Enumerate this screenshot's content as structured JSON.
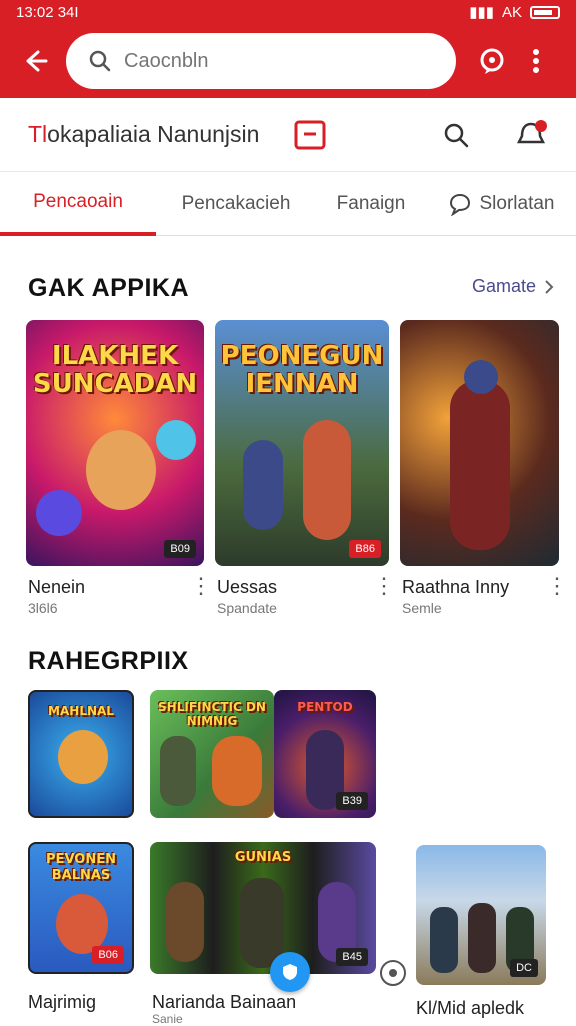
{
  "status": {
    "time": "13:02 34I",
    "battery_label": "AK"
  },
  "search": {
    "placeholder": "Caocnbln"
  },
  "header": {
    "title_prefix": "Tl",
    "title_rest": "okapaliaia Nanunjsin"
  },
  "tabs": [
    {
      "label": "Pencaoain"
    },
    {
      "label": "Pencakacieh"
    },
    {
      "label": "Fanaign"
    },
    {
      "label": "Slorlatan"
    }
  ],
  "section1": {
    "title": "GAK APPIKA",
    "see_all": "Gamate",
    "games": [
      {
        "name": "Nenein",
        "sub": "3l6l6",
        "cover_text": "ILAKHEK SUNCADAN",
        "badge": "B09"
      },
      {
        "name": "Uessas",
        "sub": "Spandate",
        "cover_text": "PEONEGUN IENNAN",
        "badge": "B86"
      },
      {
        "name": "Raathna Inny",
        "sub": "Semle",
        "cover_text": "",
        "badge": ""
      }
    ]
  },
  "section2": {
    "title": "RAHEGRPIIX",
    "row1": [
      {
        "cover_text": "MAHLNAL",
        "badge": ""
      },
      {
        "cover_text": "SHLIFINCTIC DN NIMNIG",
        "badge": ""
      },
      {
        "cover_text": "PENTOD",
        "badge": "B39"
      }
    ],
    "row2": [
      {
        "cover_text": "PEVONEN BALNAS",
        "badge": "B06",
        "label": "Majrimig"
      },
      {
        "cover_text": "GUNIAS",
        "badge": "B45",
        "label": "Narianda Bainaan"
      },
      {
        "cover_text": "",
        "badge": "DC",
        "label": "Kl/Mid apledk"
      }
    ],
    "row2_sub": "Sanie"
  },
  "colors": {
    "brand": "#d91f26",
    "link": "#4a4a8c"
  }
}
